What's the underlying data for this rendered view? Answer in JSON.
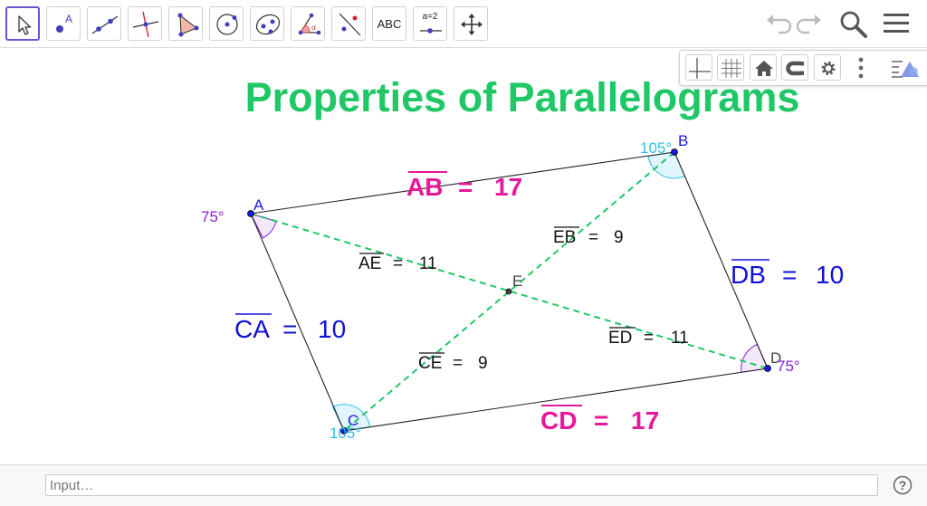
{
  "toolbar": {
    "tools": [
      {
        "name": "move-tool",
        "label": ""
      },
      {
        "name": "point-tool",
        "label": "A"
      },
      {
        "name": "line-tool",
        "label": ""
      },
      {
        "name": "perpendicular-tool",
        "label": ""
      },
      {
        "name": "polygon-tool",
        "label": ""
      },
      {
        "name": "circle-tool",
        "label": ""
      },
      {
        "name": "ellipse-tool",
        "label": ""
      },
      {
        "name": "angle-tool",
        "label": "α"
      },
      {
        "name": "reflect-tool",
        "label": ""
      },
      {
        "name": "text-tool",
        "label": "ABC"
      },
      {
        "name": "slider-tool",
        "label": "a=2"
      },
      {
        "name": "move-graphics-tool",
        "label": ""
      }
    ],
    "right_icons": [
      "undo-icon",
      "redo-icon",
      "search-icon",
      "menu-icon"
    ]
  },
  "style_bar": {
    "icons": [
      "axes-icon",
      "grid-icon",
      "home-icon",
      "point-capturing-icon",
      "settings-icon",
      "more-icon",
      "toggle-style-bar-icon"
    ]
  },
  "graphics": {
    "title": "Properties of Parallelograms",
    "points": {
      "A": "A",
      "B": "B",
      "C": "C",
      "D": "D",
      "E": "E"
    },
    "angles": {
      "A": "75°",
      "B": "105°",
      "C": "105°",
      "D": "75°"
    },
    "side_labels": {
      "AB": {
        "name": "AB",
        "value": "17"
      },
      "CD": {
        "name": "CD",
        "value": "17"
      },
      "CA": {
        "name": "CA",
        "value": "10"
      },
      "DB": {
        "name": "DB",
        "value": "10"
      }
    },
    "diagonal_labels": {
      "AE": {
        "name": "AE",
        "value": "11"
      },
      "ED": {
        "name": "ED",
        "value": "11"
      },
      "EB": {
        "name": "EB",
        "value": "9"
      },
      "CE": {
        "name": "CE",
        "value": "9"
      }
    },
    "colors": {
      "title": "#20c767",
      "side_pink": "#e5199a",
      "side_blue": "#1010d6",
      "diagonal": "#20c767",
      "angle_purple": "#8a1de0",
      "angle_cyan": "#2fbfe8",
      "point_blue": "#1a1ae6"
    }
  },
  "input_bar": {
    "placeholder": "Input…"
  }
}
